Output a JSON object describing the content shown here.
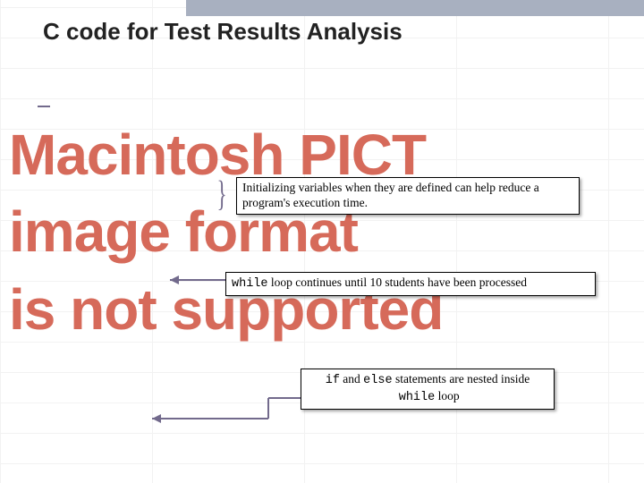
{
  "title": "C code for Test Results Analysis",
  "watermark": {
    "line1": "Macintosh PICT",
    "line2": "image format",
    "line3": "is not supported"
  },
  "callouts": {
    "c1": "Initializing variables when they are defined can help reduce a program's execution time.",
    "c2_prefix_mono": "while",
    "c2_rest": " loop continues until 10 students have been processed",
    "c3_part1_mono": "if",
    "c3_part2": " and ",
    "c3_part3_mono": "else",
    "c3_part4": " statements are nested inside ",
    "c3_part5_mono": "while",
    "c3_part6": " loop"
  }
}
